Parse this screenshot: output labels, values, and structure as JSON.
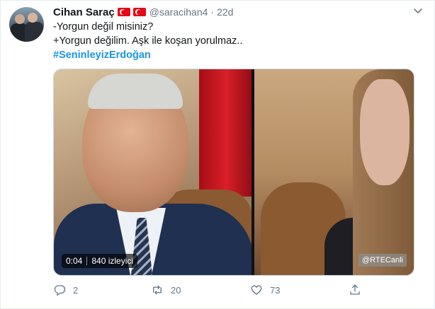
{
  "tweet": {
    "author": {
      "name": "Cihan Saraç",
      "handle": "@saracihan4"
    },
    "timestamp": "22d",
    "separator": "·",
    "text_lines": [
      "-Yorgun değil misiniz?",
      "+Yorgun değilim. Aşk ile koşan yorulmaz.."
    ],
    "hashtag": "#SeninleyizErdoğan"
  },
  "video": {
    "elapsed": "0:04",
    "views": "840 izleyici",
    "watermark": "@RTECanli"
  },
  "actions": {
    "replies": "2",
    "retweets": "20",
    "likes": "73"
  },
  "icons": {
    "reply": "reply-icon",
    "retweet": "retweet-icon",
    "like": "heart-icon",
    "share": "share-icon",
    "menu": "chevron-down-icon",
    "flag": "turkey-flag-icon"
  },
  "colors": {
    "text": "#14171a",
    "secondary": "#657786",
    "link": "#1b95e0"
  }
}
